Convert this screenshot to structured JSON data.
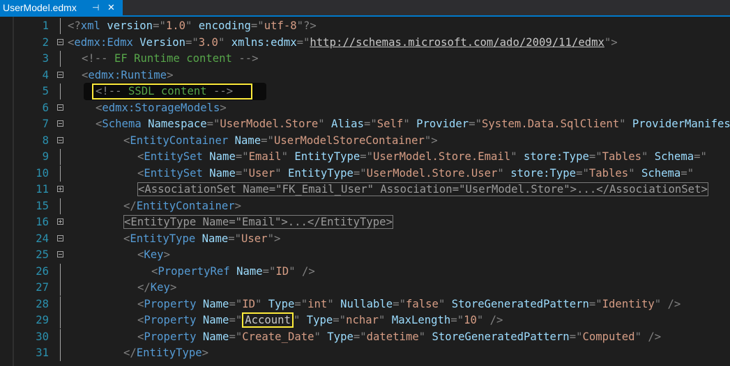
{
  "tab": {
    "title": "UserModel.edmx",
    "pin_icon": "pin-icon",
    "close_icon": "close-icon"
  },
  "lines": [
    {
      "n": "1",
      "fold": "none",
      "indent": 0,
      "tokens": [
        [
          "d",
          "<?"
        ],
        [
          "t",
          "xml"
        ],
        [
          "w",
          " "
        ],
        [
          "a",
          "version"
        ],
        [
          "d",
          "=\""
        ],
        [
          "v",
          "1.0"
        ],
        [
          "d",
          "\""
        ],
        [
          "w",
          " "
        ],
        [
          "a",
          "encoding"
        ],
        [
          "d",
          "=\""
        ],
        [
          "v",
          "utf-8"
        ],
        [
          "d",
          "\"?>"
        ]
      ]
    },
    {
      "n": "2",
      "fold": "minus",
      "indent": 0,
      "tokens": [
        [
          "d",
          "<"
        ],
        [
          "t",
          "edmx:Edmx"
        ],
        [
          "w",
          " "
        ],
        [
          "a",
          "Version"
        ],
        [
          "d",
          "=\""
        ],
        [
          "v",
          "3.0"
        ],
        [
          "d",
          "\""
        ],
        [
          "w",
          " "
        ],
        [
          "a",
          "xmlns:edmx"
        ],
        [
          "d",
          "=\""
        ],
        [
          "u",
          "http://schemas.microsoft.com/ado/2009/11/edmx"
        ],
        [
          "d",
          "\">"
        ]
      ]
    },
    {
      "n": "3",
      "fold": "none",
      "indent": 1,
      "tokens": [
        [
          "d",
          "<!--"
        ],
        [
          "c",
          " EF Runtime content "
        ],
        [
          "d",
          "-->"
        ]
      ]
    },
    {
      "n": "4",
      "fold": "minus",
      "indent": 1,
      "tokens": [
        [
          "d",
          "<"
        ],
        [
          "t",
          "edmx:Runtime"
        ],
        [
          "d",
          ">"
        ]
      ]
    },
    {
      "n": "5",
      "fold": "none",
      "indent": 2,
      "highlight": "hl-5",
      "tokens": [
        [
          "d",
          "<!--"
        ],
        [
          "c",
          " SSDL content "
        ],
        [
          "d",
          "-->"
        ]
      ]
    },
    {
      "n": "6",
      "fold": "minus",
      "indent": 2,
      "tokens": [
        [
          "d",
          "<"
        ],
        [
          "t",
          "edmx:StorageModels"
        ],
        [
          "d",
          ">"
        ]
      ]
    },
    {
      "n": "7",
      "fold": "minus",
      "indent": 2,
      "tokens": [
        [
          "d",
          "<"
        ],
        [
          "t",
          "Schema"
        ],
        [
          "w",
          " "
        ],
        [
          "a",
          "Namespace"
        ],
        [
          "d",
          "=\""
        ],
        [
          "v",
          "UserModel.Store"
        ],
        [
          "d",
          "\""
        ],
        [
          "w",
          " "
        ],
        [
          "a",
          "Alias"
        ],
        [
          "d",
          "=\""
        ],
        [
          "v",
          "Self"
        ],
        [
          "d",
          "\""
        ],
        [
          "w",
          " "
        ],
        [
          "a",
          "Provider"
        ],
        [
          "d",
          "=\""
        ],
        [
          "v",
          "System.Data.SqlClient"
        ],
        [
          "d",
          "\""
        ],
        [
          "w",
          " "
        ],
        [
          "a",
          "ProviderManifestToken"
        ]
      ]
    },
    {
      "n": "8",
      "fold": "minus",
      "indent": 4,
      "tokens": [
        [
          "d",
          "<"
        ],
        [
          "t",
          "EntityContainer"
        ],
        [
          "w",
          " "
        ],
        [
          "a",
          "Name"
        ],
        [
          "d",
          "=\""
        ],
        [
          "v",
          "UserModelStoreContainer"
        ],
        [
          "d",
          "\">"
        ]
      ]
    },
    {
      "n": "9",
      "fold": "none",
      "indent": 5,
      "tokens": [
        [
          "d",
          "<"
        ],
        [
          "t",
          "EntitySet"
        ],
        [
          "w",
          " "
        ],
        [
          "a",
          "Name"
        ],
        [
          "d",
          "=\""
        ],
        [
          "v",
          "Email"
        ],
        [
          "d",
          "\""
        ],
        [
          "w",
          " "
        ],
        [
          "a",
          "EntityType"
        ],
        [
          "d",
          "=\""
        ],
        [
          "v",
          "UserModel.Store.Email"
        ],
        [
          "d",
          "\""
        ],
        [
          "w",
          " "
        ],
        [
          "a",
          "store:Type"
        ],
        [
          "d",
          "=\""
        ],
        [
          "v",
          "Tables"
        ],
        [
          "d",
          "\""
        ],
        [
          "w",
          " "
        ],
        [
          "a",
          "Schema"
        ],
        [
          "d",
          "=\""
        ]
      ]
    },
    {
      "n": "10",
      "fold": "none",
      "indent": 5,
      "tokens": [
        [
          "d",
          "<"
        ],
        [
          "t",
          "EntitySet"
        ],
        [
          "w",
          " "
        ],
        [
          "a",
          "Name"
        ],
        [
          "d",
          "=\""
        ],
        [
          "v",
          "User"
        ],
        [
          "d",
          "\""
        ],
        [
          "w",
          " "
        ],
        [
          "a",
          "EntityType"
        ],
        [
          "d",
          "=\""
        ],
        [
          "v",
          "UserModel.Store.User"
        ],
        [
          "d",
          "\""
        ],
        [
          "w",
          " "
        ],
        [
          "a",
          "store:Type"
        ],
        [
          "d",
          "=\""
        ],
        [
          "v",
          "Tables"
        ],
        [
          "d",
          "\""
        ],
        [
          "w",
          " "
        ],
        [
          "a",
          "Schema"
        ],
        [
          "d",
          "=\""
        ]
      ]
    },
    {
      "n": "11",
      "fold": "plus",
      "indent": 5,
      "collapsed": true,
      "tokens": [
        [
          "d",
          "<"
        ],
        [
          "t",
          "AssociationSet"
        ],
        [
          "w",
          " "
        ],
        [
          "a",
          "Name"
        ],
        [
          "d",
          "=\""
        ],
        [
          "v",
          "FK_Email_User"
        ],
        [
          "d",
          "\""
        ],
        [
          "w",
          " "
        ],
        [
          "a",
          "Association"
        ],
        [
          "d",
          "=\""
        ],
        [
          "v",
          "UserModel.Store"
        ],
        [
          "d",
          "\">...</"
        ],
        [
          "t",
          "AssociationSet"
        ],
        [
          "d",
          ">"
        ]
      ]
    },
    {
      "n": "15",
      "fold": "none",
      "indent": 4,
      "tokens": [
        [
          "d",
          "</"
        ],
        [
          "t",
          "EntityContainer"
        ],
        [
          "d",
          ">"
        ]
      ]
    },
    {
      "n": "16",
      "fold": "plus",
      "indent": 4,
      "collapsed": true,
      "tokens": [
        [
          "d",
          "<"
        ],
        [
          "t",
          "EntityType"
        ],
        [
          "w",
          " "
        ],
        [
          "a",
          "Name"
        ],
        [
          "d",
          "=\""
        ],
        [
          "v",
          "Email"
        ],
        [
          "d",
          "\">...</"
        ],
        [
          "t",
          "EntityType"
        ],
        [
          "d",
          ">"
        ]
      ]
    },
    {
      "n": "24",
      "fold": "minus",
      "indent": 4,
      "tokens": [
        [
          "d",
          "<"
        ],
        [
          "t",
          "EntityType"
        ],
        [
          "w",
          " "
        ],
        [
          "a",
          "Name"
        ],
        [
          "d",
          "=\""
        ],
        [
          "v",
          "User"
        ],
        [
          "d",
          "\">"
        ]
      ]
    },
    {
      "n": "25",
      "fold": "minus",
      "indent": 5,
      "tokens": [
        [
          "d",
          "<"
        ],
        [
          "t",
          "Key"
        ],
        [
          "d",
          ">"
        ]
      ]
    },
    {
      "n": "26",
      "fold": "none",
      "indent": 6,
      "tokens": [
        [
          "d",
          "<"
        ],
        [
          "t",
          "PropertyRef"
        ],
        [
          "w",
          " "
        ],
        [
          "a",
          "Name"
        ],
        [
          "d",
          "=\""
        ],
        [
          "v",
          "ID"
        ],
        [
          "d",
          "\""
        ],
        [
          "w",
          " "
        ],
        [
          "d",
          "/>"
        ]
      ]
    },
    {
      "n": "27",
      "fold": "none",
      "indent": 5,
      "tokens": [
        [
          "d",
          "</"
        ],
        [
          "t",
          "Key"
        ],
        [
          "d",
          ">"
        ]
      ]
    },
    {
      "n": "28",
      "fold": "none",
      "indent": 5,
      "tokens": [
        [
          "d",
          "<"
        ],
        [
          "t",
          "Property"
        ],
        [
          "w",
          " "
        ],
        [
          "a",
          "Name"
        ],
        [
          "d",
          "=\""
        ],
        [
          "v",
          "ID"
        ],
        [
          "d",
          "\""
        ],
        [
          "w",
          " "
        ],
        [
          "a",
          "Type"
        ],
        [
          "d",
          "=\""
        ],
        [
          "v",
          "int"
        ],
        [
          "d",
          "\""
        ],
        [
          "w",
          " "
        ],
        [
          "a",
          "Nullable"
        ],
        [
          "d",
          "=\""
        ],
        [
          "v",
          "false"
        ],
        [
          "d",
          "\""
        ],
        [
          "w",
          " "
        ],
        [
          "a",
          "StoreGeneratedPattern"
        ],
        [
          "d",
          "=\""
        ],
        [
          "v",
          "Identity"
        ],
        [
          "d",
          "\""
        ],
        [
          "w",
          " "
        ],
        [
          "d",
          "/>"
        ]
      ]
    },
    {
      "n": "29",
      "fold": "none",
      "indent": 5,
      "tokens": [
        [
          "d",
          "<"
        ],
        [
          "t",
          "Property"
        ],
        [
          "w",
          " "
        ],
        [
          "a",
          "Name"
        ],
        [
          "d",
          "=\""
        ],
        [
          "hv",
          "Account"
        ],
        [
          "d",
          "\""
        ],
        [
          "w",
          " "
        ],
        [
          "a",
          "Type"
        ],
        [
          "d",
          "=\""
        ],
        [
          "v",
          "nchar"
        ],
        [
          "d",
          "\""
        ],
        [
          "w",
          " "
        ],
        [
          "a",
          "MaxLength"
        ],
        [
          "d",
          "=\""
        ],
        [
          "v",
          "10"
        ],
        [
          "d",
          "\""
        ],
        [
          "w",
          " "
        ],
        [
          "d",
          "/>"
        ]
      ]
    },
    {
      "n": "30",
      "fold": "none",
      "indent": 5,
      "tokens": [
        [
          "d",
          "<"
        ],
        [
          "t",
          "Property"
        ],
        [
          "w",
          " "
        ],
        [
          "a",
          "Name"
        ],
        [
          "d",
          "=\""
        ],
        [
          "v",
          "Create_Date"
        ],
        [
          "d",
          "\""
        ],
        [
          "w",
          " "
        ],
        [
          "a",
          "Type"
        ],
        [
          "d",
          "=\""
        ],
        [
          "v",
          "datetime"
        ],
        [
          "d",
          "\""
        ],
        [
          "w",
          " "
        ],
        [
          "a",
          "StoreGeneratedPattern"
        ],
        [
          "d",
          "=\""
        ],
        [
          "v",
          "Computed"
        ],
        [
          "d",
          "\""
        ],
        [
          "w",
          " "
        ],
        [
          "d",
          "/>"
        ]
      ]
    },
    {
      "n": "31",
      "fold": "none",
      "indent": 4,
      "tokens": [
        [
          "d",
          "</"
        ],
        [
          "t",
          "EntityType"
        ],
        [
          "d",
          ">"
        ]
      ]
    }
  ],
  "colors": {
    "background": "#1e1e1e",
    "line_number": "#2b91af",
    "tag": "#569cd6",
    "attribute": "#9cdcfe",
    "value": "#d69d85",
    "delimiter": "#808080",
    "comment": "#57a64a",
    "highlight_box": "#ffeb3b",
    "tab_accent": "#007acc"
  }
}
